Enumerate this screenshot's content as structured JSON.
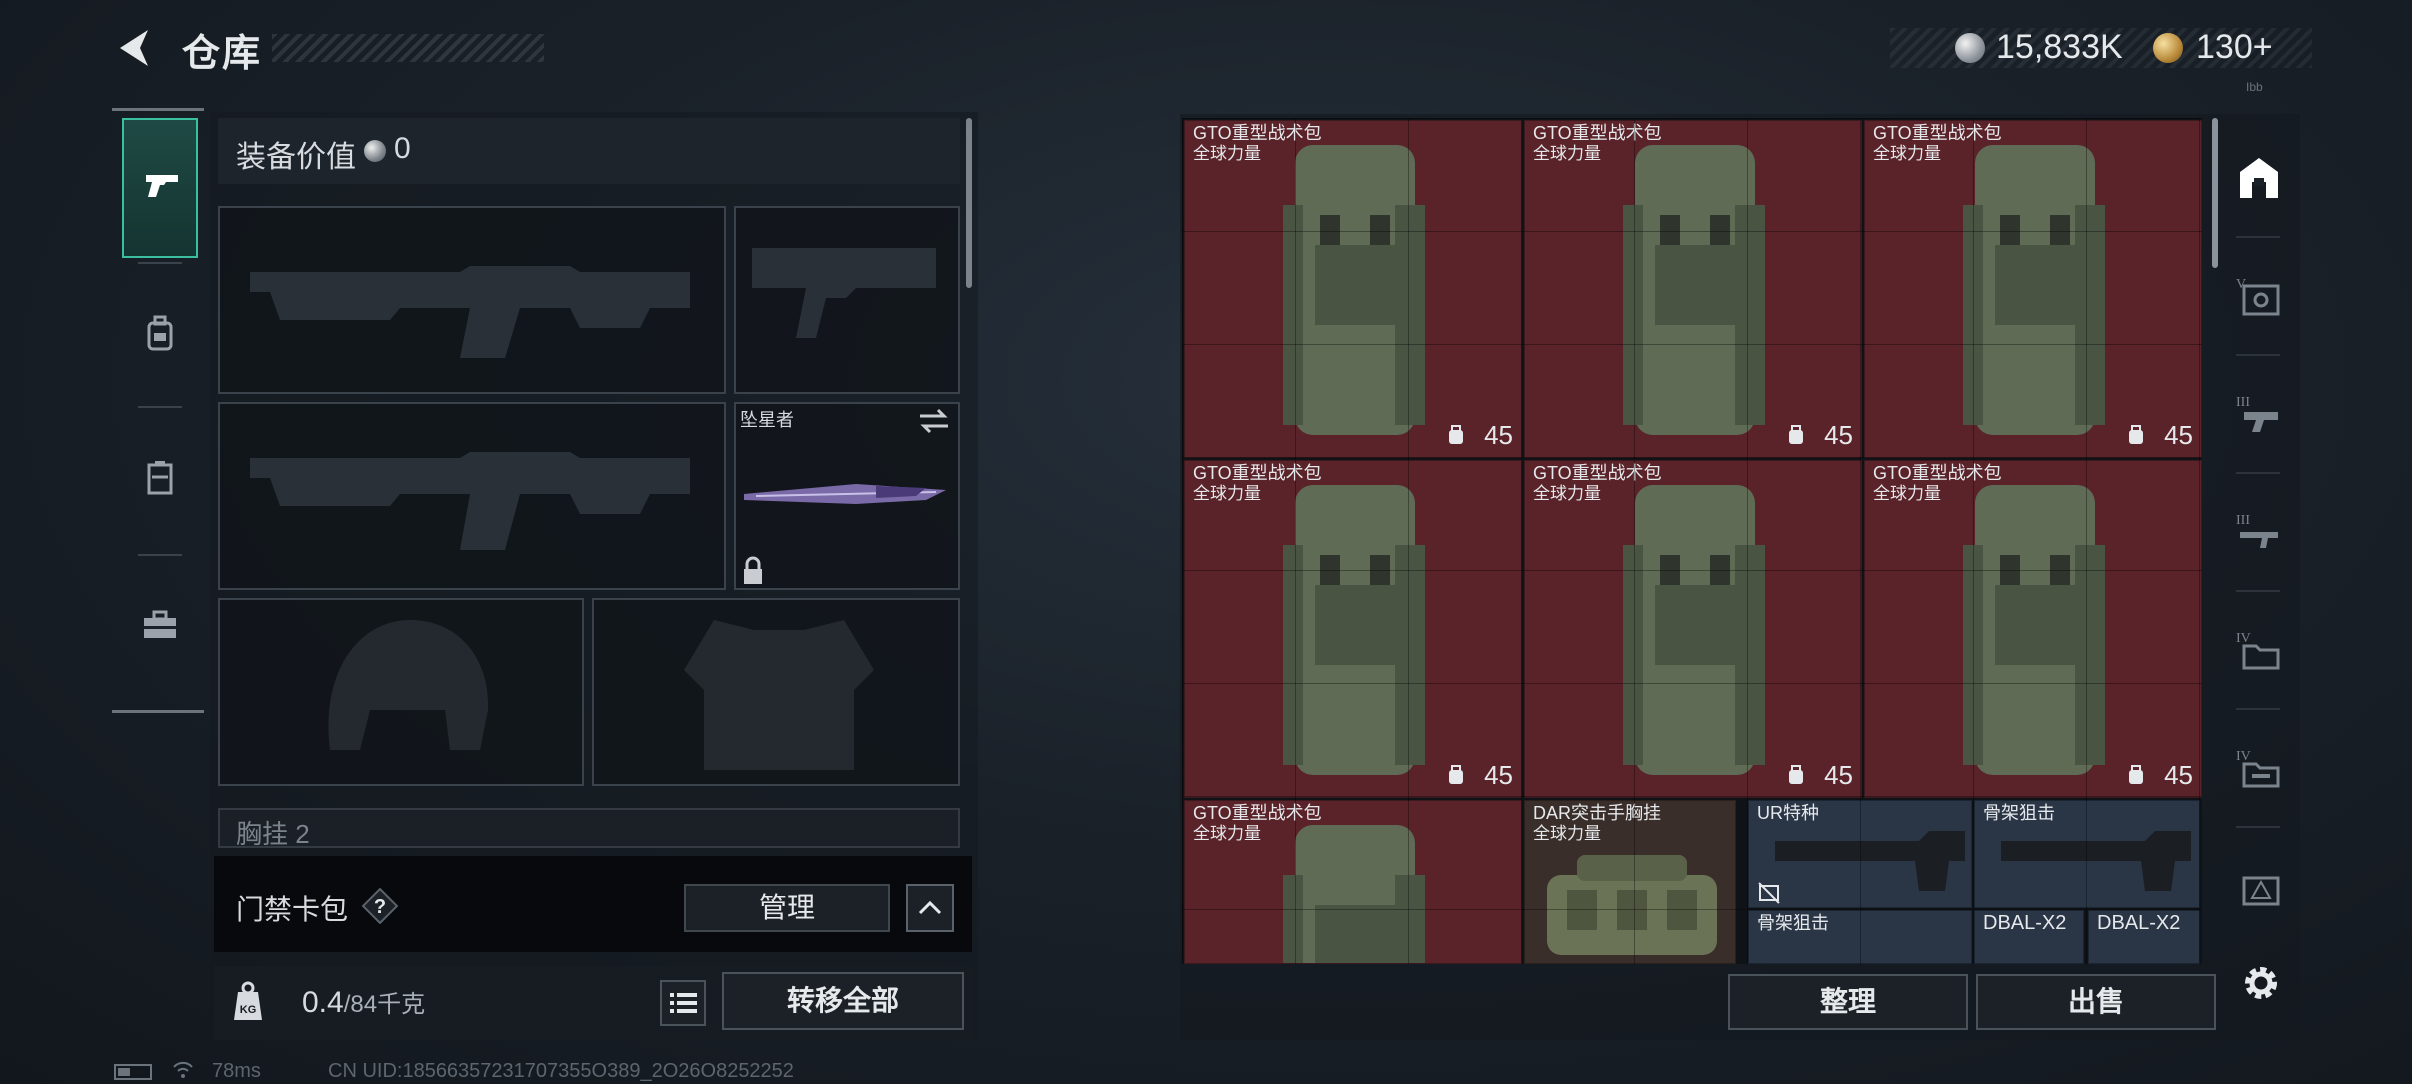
{
  "header": {
    "title": "仓库",
    "back_icon": "back-arrow-icon",
    "currency": "15,833K",
    "premium": "130+",
    "tiny_label": "Ibb"
  },
  "left_tabs": [
    {
      "icon": "pistol-icon",
      "active": true
    },
    {
      "icon": "backpack-icon",
      "active": false
    },
    {
      "icon": "locker-icon",
      "active": false
    },
    {
      "icon": "toolbox-icon",
      "active": false
    }
  ],
  "equipment": {
    "value_label": "装备价值",
    "value": "0",
    "melee_name": "坠星者",
    "chest_label": "胸挂",
    "chest_sub": "2",
    "keycard_label": "门禁卡包",
    "manage_label": "管理",
    "weight_value": "0.4",
    "weight_max": "/84千克",
    "transfer_all_label": "转移全部"
  },
  "storage": {
    "items": [
      {
        "name": "GTO重型战术包",
        "sub": "全球力量",
        "capacity": "45"
      },
      {
        "name": "GTO重型战术包",
        "sub": "全球力量",
        "capacity": "45"
      },
      {
        "name": "GTO重型战术包",
        "sub": "全球力量",
        "capacity": "45"
      },
      {
        "name": "GTO重型战术包",
        "sub": "全球力量",
        "capacity": "45"
      },
      {
        "name": "GTO重型战术包",
        "sub": "全球力量",
        "capacity": "45"
      },
      {
        "name": "GTO重型战术包",
        "sub": "全球力量",
        "capacity": "45"
      },
      {
        "name": "GTO重型战术包",
        "sub": "全球力量",
        "capacity": ""
      },
      {
        "name": "DAR突击手胸挂",
        "sub": "全球力量",
        "capacity": ""
      },
      {
        "name": "UR特种",
        "sub": "",
        "capacity": ""
      },
      {
        "name": "骨架狙击",
        "sub": "",
        "capacity": ""
      },
      {
        "name": "骨架狙击",
        "sub": "",
        "capacity": ""
      },
      {
        "name": "DBAL-X2",
        "sub": "",
        "capacity": ""
      },
      {
        "name": "DBAL-X2",
        "sub": "",
        "capacity": ""
      }
    ],
    "sort_label": "整理",
    "sell_label": "出售"
  },
  "right_categories": [
    {
      "icon": "home-storage-icon",
      "active": true
    },
    {
      "icon": "tier-v-locker-icon"
    },
    {
      "icon": "tier-iii-weapon-icon"
    },
    {
      "icon": "tier-iii-rifle-icon"
    },
    {
      "icon": "tier-iv-folder-icon"
    },
    {
      "icon": "tier-iv-case-icon"
    },
    {
      "icon": "warning-box-icon"
    }
  ],
  "status": {
    "ping": "78ms",
    "uid": "CN UID:18566357231707355O389_2O26O8252252"
  },
  "colors": {
    "accent": "#3ac0a0",
    "item_bg_red": "#5a2329",
    "item_bg_brown": "#3a2e2a",
    "item_bg_blue": "#2a3546"
  }
}
